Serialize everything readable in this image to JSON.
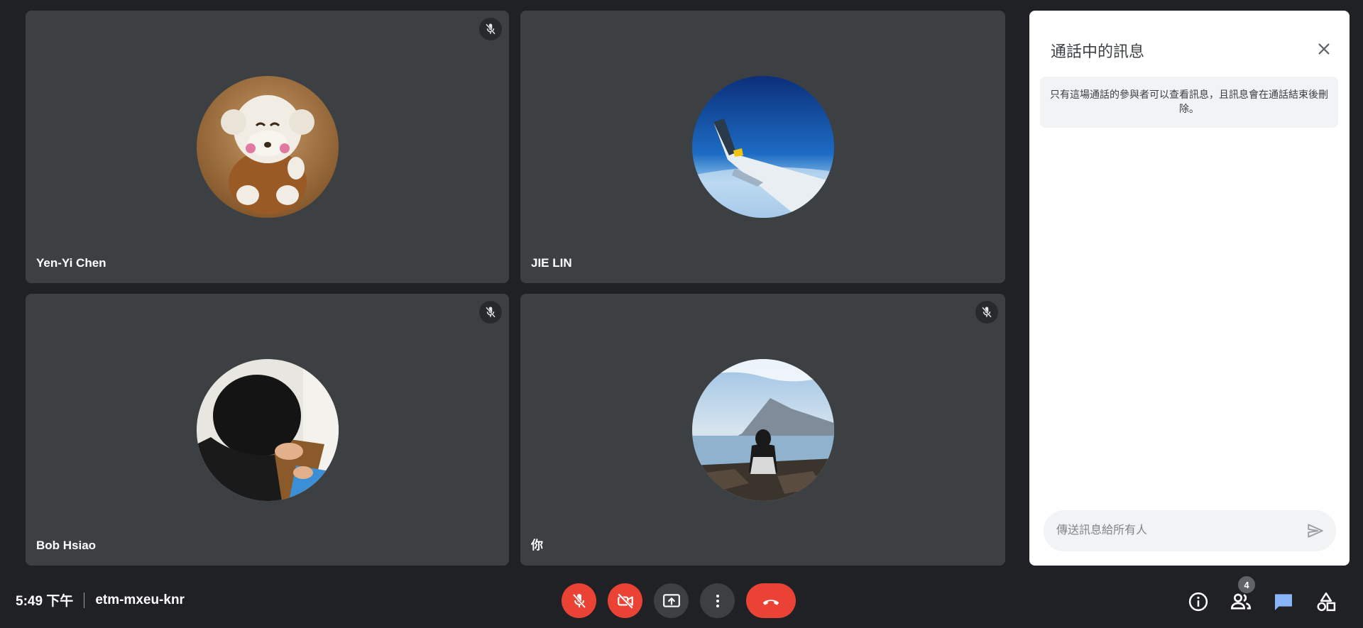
{
  "participants": [
    {
      "name": "Yen-Yi Chen",
      "muted": true,
      "avatar_icon": "stuffed-monkey-photo"
    },
    {
      "name": "JIE LIN",
      "muted": false,
      "avatar_icon": "airplane-wing-photo"
    },
    {
      "name": "Bob Hsiao",
      "muted": true,
      "avatar_icon": "person-working-photo"
    },
    {
      "name": "你",
      "muted": true,
      "avatar_icon": "seaside-person-photo"
    }
  ],
  "chat": {
    "title": "通話中的訊息",
    "notice": "只有這場通話的參與者可以查看訊息，且訊息會在通話結束後刪除。",
    "input_placeholder": "傳送訊息給所有人",
    "input_value": ""
  },
  "footer": {
    "time": "5:49 下午",
    "meeting_code": "etm-mxeu-knr",
    "participant_count": "4"
  },
  "colors": {
    "background": "#202124",
    "tile": "#3c4043",
    "danger": "#ea4335",
    "chat_active": "#8ab4f8"
  }
}
